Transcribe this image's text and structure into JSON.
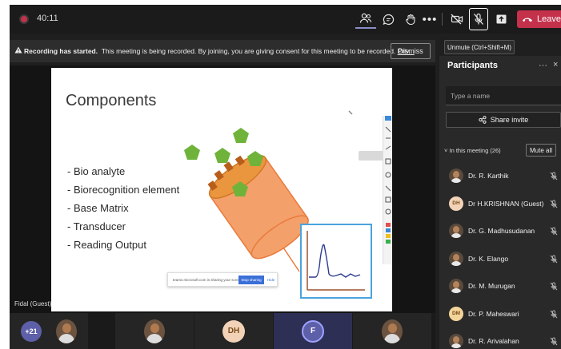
{
  "topbar": {
    "timer": "40:11",
    "leave_label": "Leave"
  },
  "tooltip": {
    "unmute": "Unmute (Ctrl+Shift+M)"
  },
  "banner": {
    "bold": "Recording has started.",
    "text": "This meeting is being recorded. By joining, you are giving consent for this meeting to be recorded.",
    "link": "Priv...",
    "dismiss_label": "Dismiss"
  },
  "slide": {
    "title": "Components",
    "bullets": [
      "- Bio analyte",
      "- Biorecognition element",
      "- Base Matrix",
      "- Transducer",
      "- Reading Output"
    ],
    "share_tip": {
      "text": "teams.microsoft.com is sharing your screen.",
      "stop_label": "Stop sharing",
      "hide_label": "Hide"
    }
  },
  "presenter_name": "Fidal (Guest)",
  "panel": {
    "title": "Participants",
    "search_placeholder": "Type a name",
    "share_invite_label": "Share invite",
    "in_meeting_label": "In this meeting (26)",
    "mute_all_label": "Mute all",
    "participants": [
      {
        "name": "Dr. R. Karthik",
        "avatar": "photo",
        "avatar_color": "#5a4a3d"
      },
      {
        "name": "Dr H.KRISHNAN (Guest)",
        "avatar": "DH",
        "avatar_color": "#f2d3b8"
      },
      {
        "name": "Dr. G. Madhusudanan",
        "avatar": "photo",
        "avatar_color": "#5a4a3d"
      },
      {
        "name": "Dr. K. Elango",
        "avatar": "photo",
        "avatar_color": "#5a4a3d"
      },
      {
        "name": "Dr. M. Murugan",
        "avatar": "photo",
        "avatar_color": "#5a4a3d"
      },
      {
        "name": "Dr. P. Maheswari",
        "avatar": "DM",
        "avatar_color": "#f3d59a"
      },
      {
        "name": "Dr. R. Arivalahan",
        "avatar": "photo",
        "avatar_color": "#5a4a3d"
      }
    ]
  },
  "gallery": {
    "overflow_count": "+21",
    "tiles": [
      {
        "type": "photo"
      },
      {
        "type": "photo"
      },
      {
        "type": "initials",
        "label": "DH",
        "color": "#f2d3b8",
        "text_color": "#7a4a1a"
      },
      {
        "type": "initials",
        "label": "F",
        "color": "#5d5fa8",
        "text_color": "#ffffff"
      },
      {
        "type": "photo"
      }
    ]
  },
  "colors": {
    "leave": "#c4314b",
    "accent": "#8b8cc7"
  }
}
